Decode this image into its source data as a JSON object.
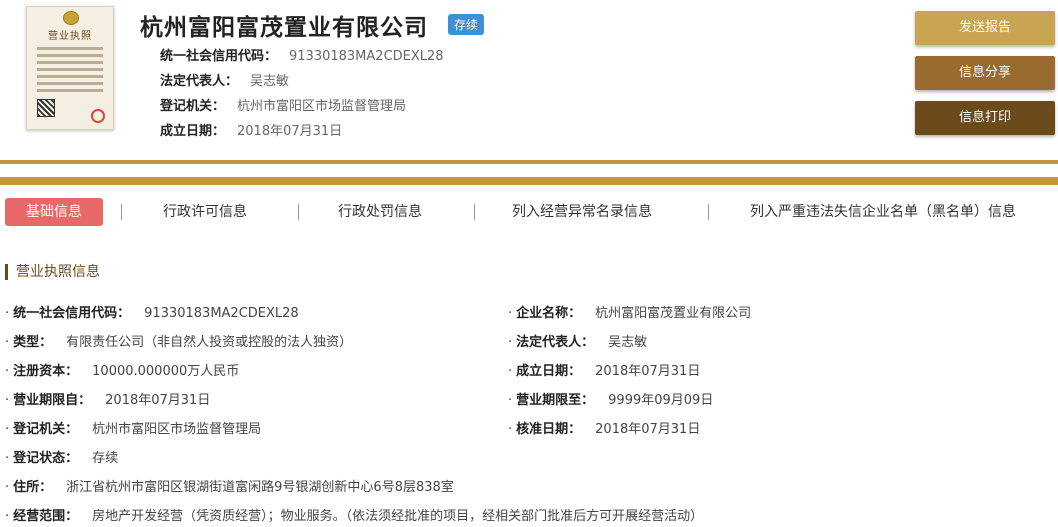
{
  "license_image": {
    "title": "营业执照"
  },
  "company": {
    "name": "杭州富阳富茂置业有限公司",
    "status": "存续",
    "credit_code_label": "统一社会信用代码：",
    "credit_code": "91330183MA2CDEXL28",
    "legal_rep_label": "法定代表人：",
    "legal_rep": "吴志敏",
    "registry_label": "登记机关：",
    "registry": "杭州市富阳区市场监督管理局",
    "established_label": "成立日期：",
    "established": "2018年07月31日"
  },
  "actions": {
    "send_report": "发送报告",
    "share_info": "信息分享",
    "print_info": "信息打印"
  },
  "tabs": [
    {
      "label": "基础信息"
    },
    {
      "label": "行政许可信息"
    },
    {
      "label": "行政处罚信息"
    },
    {
      "label": "列入经营异常名录信息"
    },
    {
      "label": "列入严重违法失信企业名单（黑名单）信息"
    }
  ],
  "section": {
    "title": "营业执照信息",
    "fields": {
      "credit_code": {
        "label": "统一社会信用代码：",
        "value": "91330183MA2CDEXL28"
      },
      "company_name": {
        "label": "企业名称：",
        "value": "杭州富阳富茂置业有限公司"
      },
      "type": {
        "label": "类型：",
        "value": "有限责任公司（非自然人投资或控股的法人独资）"
      },
      "legal_rep": {
        "label": "法定代表人：",
        "value": "吴志敏"
      },
      "reg_capital": {
        "label": "注册资本：",
        "value": "10000.000000万人民币"
      },
      "established": {
        "label": "成立日期：",
        "value": "2018年07月31日"
      },
      "term_from": {
        "label": "营业期限自：",
        "value": "2018年07月31日"
      },
      "term_to": {
        "label": "营业期限至：",
        "value": "9999年09月09日"
      },
      "registry": {
        "label": "登记机关：",
        "value": "杭州市富阳区市场监督管理局"
      },
      "approval_date": {
        "label": "核准日期：",
        "value": "2018年07月31日"
      },
      "reg_status": {
        "label": "登记状态：",
        "value": "存续"
      },
      "address": {
        "label": "住所：",
        "value": "浙江省杭州市富阳区银湖街道富闲路9号银湖创新中心6号8层838室"
      },
      "scope": {
        "label": "经营范围：",
        "value": "房地产开发经营（凭资质经营）；物业服务。（依法须经批准的项目，经相关部门批准后方可开展经营活动）"
      }
    }
  },
  "colors": {
    "gold_divider": "#c7973e",
    "btn_send": "#c9a452",
    "btn_share": "#9a6b2e",
    "btn_print": "#6b4a1c",
    "active_tab": "#e8686a",
    "status_tag": "#3d8fd6"
  }
}
